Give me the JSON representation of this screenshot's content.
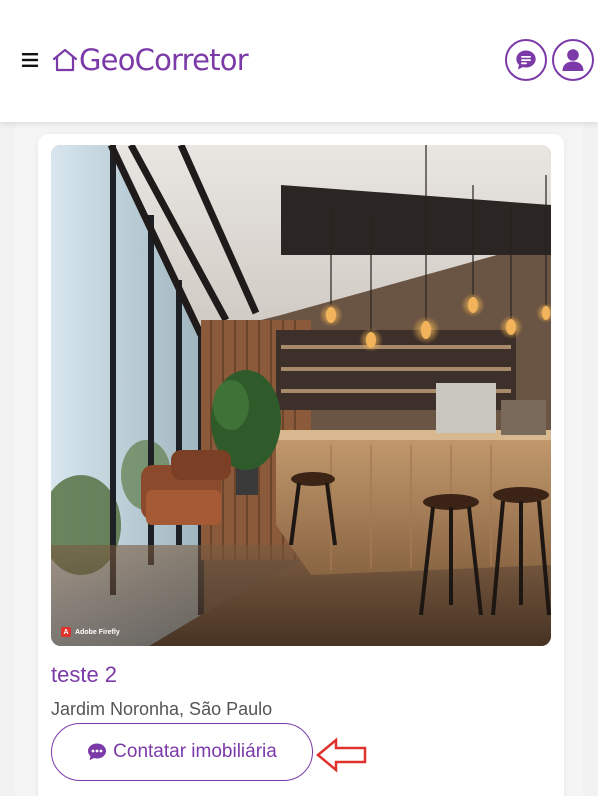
{
  "header": {
    "brand": "GeoCorretor",
    "menu_icon": "hamburger-menu-icon",
    "chat_icon": "chat-bubble-icon",
    "user_icon": "user-profile-icon"
  },
  "listing": {
    "badge_text": "Adobe Firefly",
    "title": "teste 2",
    "location": "Jardim Noronha, São Paulo",
    "contact_label": "Contatar imobiliária",
    "contact_icon": "comment-dots-icon"
  },
  "annotation": {
    "arrow_icon": "red-arrow-left-icon"
  },
  "colors": {
    "brand": "#7b3aa8",
    "arrow": "#e0322c",
    "text_secondary": "#555555"
  }
}
